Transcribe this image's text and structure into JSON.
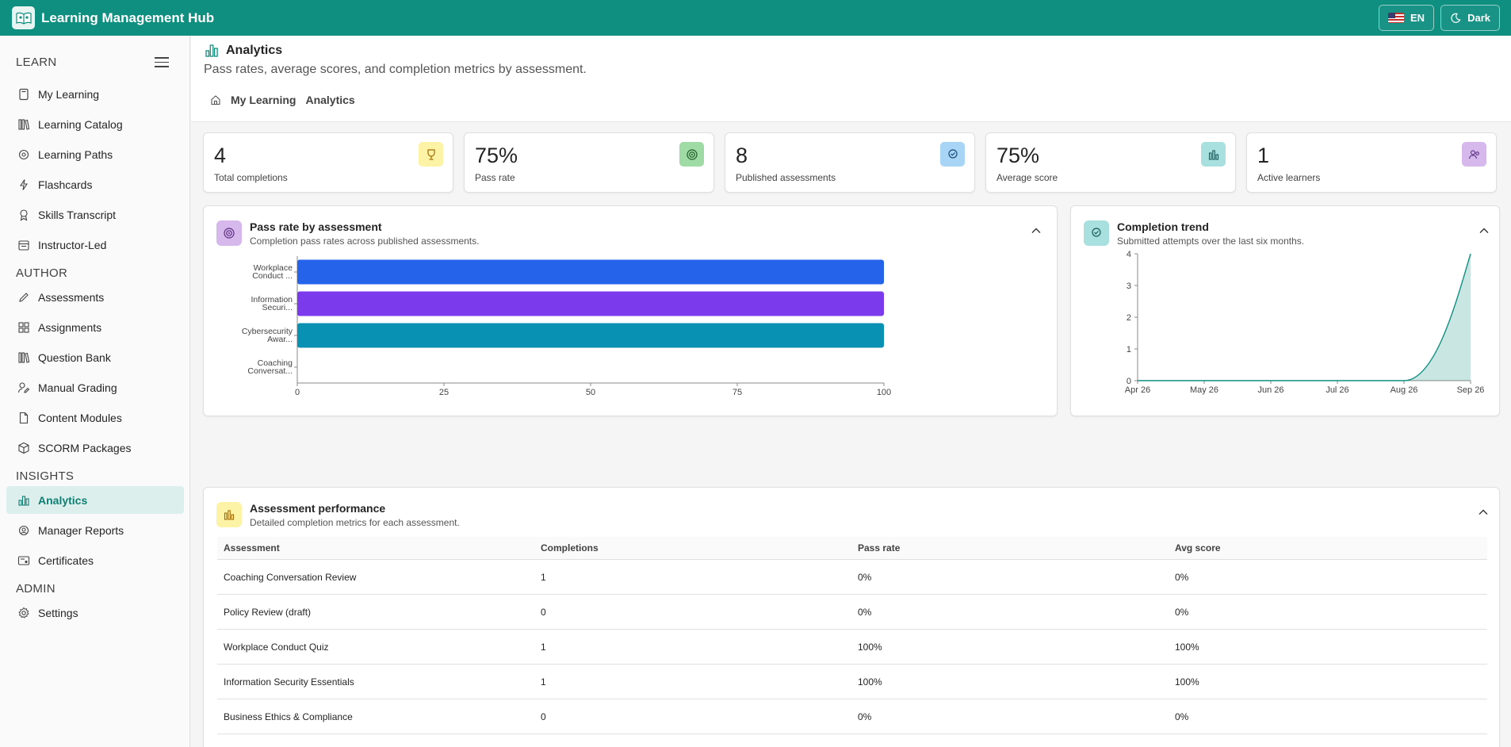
{
  "app": {
    "title": "Learning Management Hub"
  },
  "topbar": {
    "language_label": "EN",
    "theme_label": "Dark"
  },
  "sidebar": {
    "sections": [
      {
        "label": "LEARN",
        "items": [
          "My Learning",
          "Learning Catalog",
          "Learning Paths",
          "Flashcards",
          "Skills Transcript",
          "Instructor-Led"
        ]
      },
      {
        "label": "AUTHOR",
        "items": [
          "Assessments",
          "Assignments",
          "Question Bank",
          "Manual Grading",
          "Content Modules",
          "SCORM Packages"
        ]
      },
      {
        "label": "INSIGHTS",
        "items": [
          "Analytics",
          "Manager Reports",
          "Certificates"
        ]
      },
      {
        "label": "ADMIN",
        "items": [
          "Settings"
        ]
      }
    ],
    "active_item": "Analytics"
  },
  "page": {
    "title": "Analytics",
    "subtitle": "Pass rates, average scores, and completion metrics by assessment.",
    "breadcrumb": [
      "My Learning",
      "Analytics"
    ]
  },
  "kpis": [
    {
      "value": "4",
      "label": "Total completions",
      "icon": "trophy-icon",
      "color": "#fdf3a6"
    },
    {
      "value": "75%",
      "label": "Pass rate",
      "icon": "target-icon",
      "color": "#9fdca5"
    },
    {
      "value": "8",
      "label": "Published assessments",
      "icon": "badge-icon",
      "color": "#a8d4f5"
    },
    {
      "value": "75%",
      "label": "Average score",
      "icon": "bar-chart-icon",
      "color": "#a7e0df"
    },
    {
      "value": "1",
      "label": "Active learners",
      "icon": "people-icon",
      "color": "#d6b8ec"
    }
  ],
  "pass_rate_card": {
    "title": "Pass rate by assessment",
    "subtitle": "Completion pass rates across published assessments."
  },
  "trend_card": {
    "title": "Completion trend",
    "subtitle": "Submitted attempts over the last six months."
  },
  "performance_card": {
    "title": "Assessment performance",
    "subtitle": "Detailed completion metrics for each assessment.",
    "columns": [
      "Assessment",
      "Completions",
      "Pass rate",
      "Avg score"
    ],
    "rows": [
      [
        "Coaching Conversation Review",
        "1",
        "0%",
        "0%"
      ],
      [
        "Policy Review (draft)",
        "0",
        "0%",
        "0%"
      ],
      [
        "Workplace Conduct Quiz",
        "1",
        "100%",
        "100%"
      ],
      [
        "Information Security Essentials",
        "1",
        "100%",
        "100%"
      ],
      [
        "Business Ethics & Compliance",
        "0",
        "0%",
        "0%"
      ]
    ]
  },
  "chart_data": [
    {
      "type": "bar",
      "orientation": "horizontal",
      "categories": [
        [
          "Workplace",
          "Conduct ..."
        ],
        [
          "Information",
          "Securi..."
        ],
        [
          "Cybersecurity",
          "Awar..."
        ],
        [
          "Coaching",
          "Conversat..."
        ]
      ],
      "values": [
        100,
        100,
        100,
        0
      ],
      "colors": [
        "#2563eb",
        "#7c3aed",
        "#0891b2",
        "#0f8f80"
      ],
      "xlim": [
        0,
        100
      ],
      "xticks": [
        "0",
        "25",
        "50",
        "75",
        "100"
      ],
      "grid": false
    },
    {
      "type": "area",
      "x": [
        "Apr 26",
        "May 26",
        "Jun 26",
        "Jul 26",
        "Aug 26",
        "Sep 26"
      ],
      "y": [
        0,
        0,
        0,
        0,
        0,
        4
      ],
      "ylim": [
        0,
        4
      ],
      "yticks": [
        "0",
        "1",
        "2",
        "3",
        "4"
      ],
      "color": "#0f8f80",
      "grid": false
    }
  ]
}
